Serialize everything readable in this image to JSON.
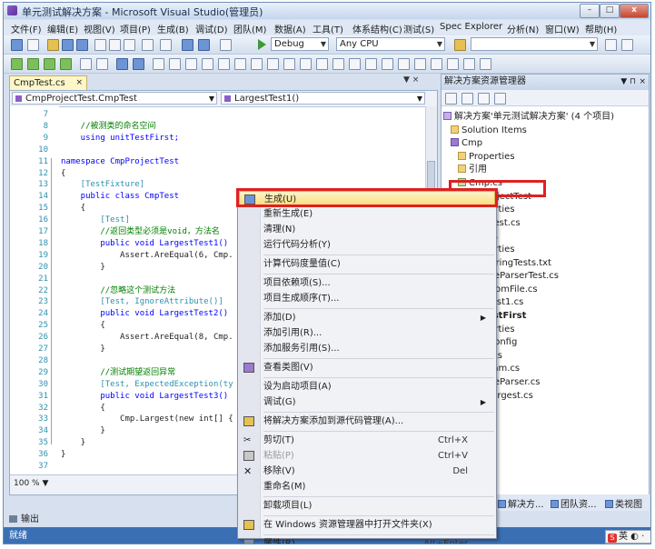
{
  "window": {
    "title": "单元测试解决方案 - Microsoft Visual Studio(管理员)"
  },
  "menu": [
    "文件(F)",
    "编辑(E)",
    "视图(V)",
    "项目(P)",
    "生成(B)",
    "调试(D)",
    "团队(M)",
    "数据(A)",
    "工具(T)",
    "体系结构(C)",
    "测试(S)",
    "Spec Explorer",
    "分析(N)",
    "窗口(W)",
    "帮助(H)"
  ],
  "toolbar": {
    "config": "Debug",
    "platform": "Any CPU"
  },
  "doc_tab": {
    "label": "CmpTest.cs"
  },
  "editor": {
    "class_combo": "CmpProjectTest.CmpTest",
    "member_combo": "LargestTest1()",
    "zoom": "100 %",
    "lines": [
      {
        "n": "7",
        "text": ""
      },
      {
        "n": "8",
        "text": "    //被测类的命名空间"
      },
      {
        "n": "9",
        "text": "    using unitTestFirst;"
      },
      {
        "n": "10",
        "text": ""
      },
      {
        "n": "11",
        "text": "namespace CmpProjectTest"
      },
      {
        "n": "12",
        "text": "{"
      },
      {
        "n": "13",
        "text": "    [TestFixture]"
      },
      {
        "n": "14",
        "text": "    public class CmpTest"
      },
      {
        "n": "15",
        "text": "    {"
      },
      {
        "n": "16",
        "text": "        [Test]"
      },
      {
        "n": "17",
        "text": "        //返回类型必须是void，方法名"
      },
      {
        "n": "18",
        "text": "        public void LargestTest1()"
      },
      {
        "n": "19",
        "text": "            Assert.AreEqual(6, Cmp."
      },
      {
        "n": "20",
        "text": "        }"
      },
      {
        "n": "21",
        "text": ""
      },
      {
        "n": "22",
        "text": "        //忽略这个测试方法"
      },
      {
        "n": "23",
        "text": "        [Test, IgnoreAttribute()]"
      },
      {
        "n": "24",
        "text": "        public void LargestTest2()"
      },
      {
        "n": "25",
        "text": "        {"
      },
      {
        "n": "26",
        "text": "            Assert.AreEqual(8, Cmp."
      },
      {
        "n": "27",
        "text": "        }"
      },
      {
        "n": "28",
        "text": ""
      },
      {
        "n": "29",
        "text": "        //测试期望返回异常"
      },
      {
        "n": "30",
        "text": "        [Test, ExpectedException(ty"
      },
      {
        "n": "31",
        "text": "        public void LargestTest3()"
      },
      {
        "n": "32",
        "text": "        {"
      },
      {
        "n": "33",
        "text": "            Cmp.Largest(new int[] {"
      },
      {
        "n": "34",
        "text": "        }"
      },
      {
        "n": "35",
        "text": "    }"
      },
      {
        "n": "36",
        "text": "}"
      },
      {
        "n": "37",
        "text": ""
      }
    ]
  },
  "explorer": {
    "title": "解决方案资源管理器",
    "items": [
      "解决方案'单元测试解决方案' (4 个项目)",
      "Solution Items",
      "Cmp",
      "Properties",
      "引用",
      "Cmp.cs",
      "CmpProjectTest",
      "Properties",
      "CmpTest.cs",
      "Project1",
      "Properties",
      "AuthoringTests.txt",
      "SimpleParserTest.cs",
      "TextFromFile.cs",
      "UnitTest1.cs",
      "unitTestFirst",
      "Properties",
      "App.config",
      "Cmp.cs",
      "Program.cs",
      "SimpleParser.cs",
      "TestLargest.cs"
    ],
    "bottom_tabs": [
      "解决方...",
      "团队资...",
      "类视图"
    ]
  },
  "context_menu": [
    {
      "label": "生成(U)",
      "shortcut": "",
      "sub": false,
      "disabled": false,
      "icon": "build-icon",
      "hl": true
    },
    {
      "label": "重新生成(E)",
      "shortcut": "",
      "sub": false,
      "disabled": false,
      "icon": ""
    },
    {
      "label": "清理(N)",
      "shortcut": "",
      "sub": false,
      "disabled": false,
      "icon": ""
    },
    {
      "label": "运行代码分析(Y)",
      "shortcut": "",
      "sub": false,
      "disabled": false,
      "icon": ""
    },
    {
      "sep": true
    },
    {
      "label": "计算代码度量值(C)",
      "shortcut": "",
      "sub": false,
      "disabled": false,
      "icon": ""
    },
    {
      "sep": true
    },
    {
      "label": "项目依赖项(S)...",
      "shortcut": "",
      "sub": false,
      "disabled": false,
      "icon": ""
    },
    {
      "label": "项目生成顺序(T)...",
      "shortcut": "",
      "sub": false,
      "disabled": false,
      "icon": ""
    },
    {
      "sep": true
    },
    {
      "label": "添加(D)",
      "shortcut": "",
      "sub": true,
      "disabled": false,
      "icon": ""
    },
    {
      "label": "添加引用(R)...",
      "shortcut": "",
      "sub": false,
      "disabled": false,
      "icon": ""
    },
    {
      "label": "添加服务引用(S)...",
      "shortcut": "",
      "sub": false,
      "disabled": false,
      "icon": ""
    },
    {
      "sep": true
    },
    {
      "label": "查看类图(V)",
      "shortcut": "",
      "sub": false,
      "disabled": false,
      "icon": "class-diagram-icon"
    },
    {
      "sep": true
    },
    {
      "label": "设为启动项目(A)",
      "shortcut": "",
      "sub": false,
      "disabled": false,
      "icon": ""
    },
    {
      "label": "调试(G)",
      "shortcut": "",
      "sub": true,
      "disabled": false,
      "icon": ""
    },
    {
      "sep": true
    },
    {
      "label": "将解决方案添加到源代码管理(A)...",
      "shortcut": "",
      "sub": false,
      "disabled": false,
      "icon": "source-control-icon"
    },
    {
      "sep": true
    },
    {
      "label": "剪切(T)",
      "shortcut": "Ctrl+X",
      "sub": false,
      "disabled": false,
      "icon": "cut-icon"
    },
    {
      "label": "粘贴(P)",
      "shortcut": "Ctrl+V",
      "sub": false,
      "disabled": true,
      "icon": "paste-icon"
    },
    {
      "label": "移除(V)",
      "shortcut": "Del",
      "sub": false,
      "disabled": false,
      "icon": "remove-icon"
    },
    {
      "label": "重命名(M)",
      "shortcut": "",
      "sub": false,
      "disabled": false,
      "icon": ""
    },
    {
      "sep": true
    },
    {
      "label": "卸载项目(L)",
      "shortcut": "",
      "sub": false,
      "disabled": false,
      "icon": ""
    },
    {
      "sep": true
    },
    {
      "label": "在 Windows 资源管理器中打开文件夹(X)",
      "shortcut": "",
      "sub": false,
      "disabled": false,
      "icon": "open-folder-icon"
    },
    {
      "sep": true
    },
    {
      "label": "属性(R)",
      "shortcut": "Alt+Enter",
      "sub": false,
      "disabled": false,
      "icon": "properties-icon"
    }
  ],
  "output_tab": "输出",
  "status": "就绪",
  "ime": "英"
}
